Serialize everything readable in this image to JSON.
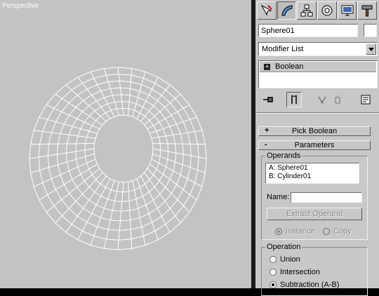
{
  "viewport": {
    "label": "Perspective"
  },
  "command_panel": {
    "tabs": [
      {
        "name": "create-tab",
        "icon": "create-icon"
      },
      {
        "name": "modify-tab",
        "icon": "modify-icon",
        "active": true
      },
      {
        "name": "hierarchy-tab",
        "icon": "hierarchy-icon"
      },
      {
        "name": "motion-tab",
        "icon": "motion-icon"
      },
      {
        "name": "display-tab",
        "icon": "display-icon"
      },
      {
        "name": "utilities-tab",
        "icon": "hammer-icon"
      }
    ],
    "object_name": "Sphere01",
    "modifier_list": "Modifier List",
    "stack_item": "Boolean",
    "stack_item_expand": "+"
  },
  "rollouts": {
    "pick_boolean": {
      "sign": "+",
      "title": "Pick Boolean"
    },
    "parameters": {
      "sign": "-",
      "title": "Parameters"
    }
  },
  "operands": {
    "group_label": "Operands",
    "items": [
      "A: Sphere01",
      "B: Cylinder01"
    ],
    "name_label": "Name:",
    "name_value": "",
    "extract_button": "Extract Operand",
    "instance_label": "Instance",
    "copy_label": "Copy"
  },
  "operation": {
    "group_label": "Operation",
    "union": "Union",
    "intersection": "Intersection",
    "subtraction": "Subtraction (A-B)",
    "selected": "subtraction"
  },
  "colors": {
    "viewport_bg": "#c3c3c3",
    "wireframe": "#ffffff",
    "panel_bg": "#c8c8c8"
  }
}
